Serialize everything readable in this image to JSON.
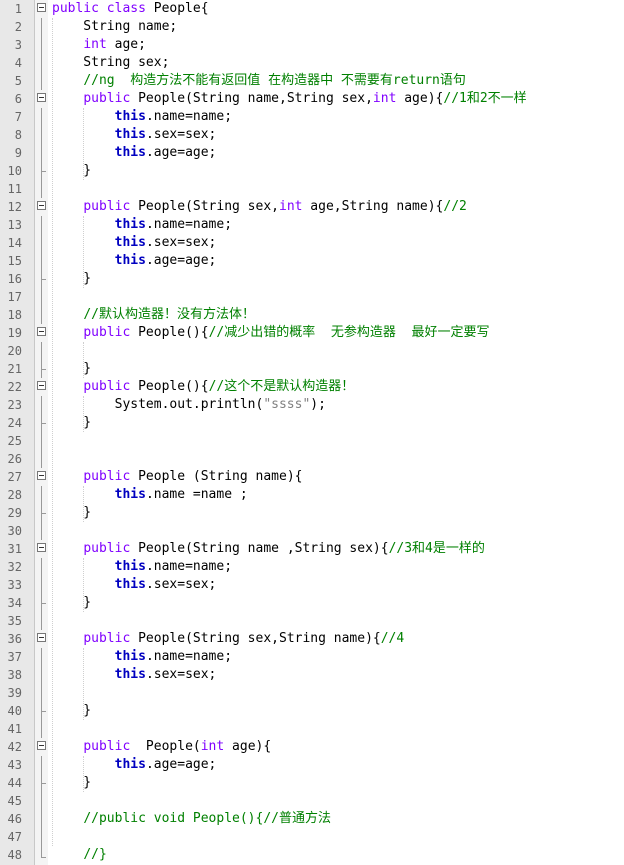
{
  "editor": {
    "lines": [
      {
        "num": "1",
        "fold": "open",
        "tokens": [
          {
            "t": "kw",
            "v": "public class"
          },
          {
            "t": "plain",
            "v": " People{"
          }
        ]
      },
      {
        "num": "2",
        "fold": "vline",
        "tokens": [
          {
            "t": "plain",
            "v": "    String name;"
          }
        ]
      },
      {
        "num": "3",
        "fold": "vline",
        "tokens": [
          {
            "t": "plain",
            "v": "    "
          },
          {
            "t": "kw",
            "v": "int"
          },
          {
            "t": "plain",
            "v": " age;"
          }
        ]
      },
      {
        "num": "4",
        "fold": "vline",
        "tokens": [
          {
            "t": "plain",
            "v": "    String sex;"
          }
        ]
      },
      {
        "num": "5",
        "fold": "vline",
        "tokens": [
          {
            "t": "plain",
            "v": "    "
          },
          {
            "t": "cm",
            "v": "//ng  构造方法不能有返回值 在构造器中 不需要有return语句"
          }
        ]
      },
      {
        "num": "6",
        "fold": "open",
        "tokens": [
          {
            "t": "plain",
            "v": "    "
          },
          {
            "t": "kw",
            "v": "public"
          },
          {
            "t": "plain",
            "v": " People(String name,String sex,"
          },
          {
            "t": "kw",
            "v": "int"
          },
          {
            "t": "plain",
            "v": " age){"
          },
          {
            "t": "cm",
            "v": "//1和2不一样"
          }
        ]
      },
      {
        "num": "7",
        "fold": "vline",
        "tokens": [
          {
            "t": "plain",
            "v": "        "
          },
          {
            "t": "this",
            "v": "this"
          },
          {
            "t": "plain",
            "v": ".name=name;"
          }
        ]
      },
      {
        "num": "8",
        "fold": "vline",
        "tokens": [
          {
            "t": "plain",
            "v": "        "
          },
          {
            "t": "this",
            "v": "this"
          },
          {
            "t": "plain",
            "v": ".sex=sex;"
          }
        ]
      },
      {
        "num": "9",
        "fold": "vline",
        "tokens": [
          {
            "t": "plain",
            "v": "        "
          },
          {
            "t": "this",
            "v": "this"
          },
          {
            "t": "plain",
            "v": ".age=age;"
          }
        ]
      },
      {
        "num": "10",
        "fold": "tick",
        "tokens": [
          {
            "t": "plain",
            "v": "    }"
          }
        ]
      },
      {
        "num": "11",
        "fold": "vline",
        "tokens": []
      },
      {
        "num": "12",
        "fold": "open",
        "tokens": [
          {
            "t": "plain",
            "v": "    "
          },
          {
            "t": "kw",
            "v": "public"
          },
          {
            "t": "plain",
            "v": " People(String sex,"
          },
          {
            "t": "kw",
            "v": "int"
          },
          {
            "t": "plain",
            "v": " age,String name){"
          },
          {
            "t": "cm",
            "v": "//2"
          }
        ]
      },
      {
        "num": "13",
        "fold": "vline",
        "tokens": [
          {
            "t": "plain",
            "v": "        "
          },
          {
            "t": "this",
            "v": "this"
          },
          {
            "t": "plain",
            "v": ".name=name;"
          }
        ]
      },
      {
        "num": "14",
        "fold": "vline",
        "tokens": [
          {
            "t": "plain",
            "v": "        "
          },
          {
            "t": "this",
            "v": "this"
          },
          {
            "t": "plain",
            "v": ".sex=sex;"
          }
        ]
      },
      {
        "num": "15",
        "fold": "vline",
        "tokens": [
          {
            "t": "plain",
            "v": "        "
          },
          {
            "t": "this",
            "v": "this"
          },
          {
            "t": "plain",
            "v": ".age=age;"
          }
        ]
      },
      {
        "num": "16",
        "fold": "tick",
        "tokens": [
          {
            "t": "plain",
            "v": "    }"
          }
        ]
      },
      {
        "num": "17",
        "fold": "vline",
        "tokens": []
      },
      {
        "num": "18",
        "fold": "vline",
        "tokens": [
          {
            "t": "plain",
            "v": "    "
          },
          {
            "t": "cm",
            "v": "//默认构造器！没有方法体！"
          }
        ]
      },
      {
        "num": "19",
        "fold": "open",
        "tokens": [
          {
            "t": "plain",
            "v": "    "
          },
          {
            "t": "kw",
            "v": "public"
          },
          {
            "t": "plain",
            "v": " People(){"
          },
          {
            "t": "cm",
            "v": "//减少出错的概率  无参构造器  最好一定要写"
          }
        ]
      },
      {
        "num": "20",
        "fold": "vline",
        "tokens": []
      },
      {
        "num": "21",
        "fold": "tick",
        "tokens": [
          {
            "t": "plain",
            "v": "    }"
          }
        ]
      },
      {
        "num": "22",
        "fold": "open",
        "tokens": [
          {
            "t": "plain",
            "v": "    "
          },
          {
            "t": "kw",
            "v": "public"
          },
          {
            "t": "plain",
            "v": " People(){"
          },
          {
            "t": "cm",
            "v": "//这个不是默认构造器！"
          }
        ]
      },
      {
        "num": "23",
        "fold": "vline",
        "tokens": [
          {
            "t": "plain",
            "v": "        System.out.println("
          },
          {
            "t": "str",
            "v": "\"ssss\""
          },
          {
            "t": "plain",
            "v": ");"
          }
        ]
      },
      {
        "num": "24",
        "fold": "tick",
        "tokens": [
          {
            "t": "plain",
            "v": "    }"
          }
        ]
      },
      {
        "num": "25",
        "fold": "vline",
        "tokens": []
      },
      {
        "num": "26",
        "fold": "vline",
        "tokens": []
      },
      {
        "num": "27",
        "fold": "open",
        "tokens": [
          {
            "t": "plain",
            "v": "    "
          },
          {
            "t": "kw",
            "v": "public"
          },
          {
            "t": "plain",
            "v": " People (String name){"
          }
        ]
      },
      {
        "num": "28",
        "fold": "vline",
        "tokens": [
          {
            "t": "plain",
            "v": "        "
          },
          {
            "t": "this",
            "v": "this"
          },
          {
            "t": "plain",
            "v": ".name =name ;"
          }
        ]
      },
      {
        "num": "29",
        "fold": "tick",
        "tokens": [
          {
            "t": "plain",
            "v": "    }"
          }
        ]
      },
      {
        "num": "30",
        "fold": "vline",
        "tokens": []
      },
      {
        "num": "31",
        "fold": "open",
        "tokens": [
          {
            "t": "plain",
            "v": "    "
          },
          {
            "t": "kw",
            "v": "public"
          },
          {
            "t": "plain",
            "v": " People(String name ,String sex){"
          },
          {
            "t": "cm",
            "v": "//3和4是一样的"
          }
        ]
      },
      {
        "num": "32",
        "fold": "vline",
        "tokens": [
          {
            "t": "plain",
            "v": "        "
          },
          {
            "t": "this",
            "v": "this"
          },
          {
            "t": "plain",
            "v": ".name=name;"
          }
        ]
      },
      {
        "num": "33",
        "fold": "vline",
        "tokens": [
          {
            "t": "plain",
            "v": "        "
          },
          {
            "t": "this",
            "v": "this"
          },
          {
            "t": "plain",
            "v": ".sex=sex;"
          }
        ]
      },
      {
        "num": "34",
        "fold": "tick",
        "tokens": [
          {
            "t": "plain",
            "v": "    }"
          }
        ]
      },
      {
        "num": "35",
        "fold": "vline",
        "tokens": []
      },
      {
        "num": "36",
        "fold": "open",
        "tokens": [
          {
            "t": "plain",
            "v": "    "
          },
          {
            "t": "kw",
            "v": "public"
          },
          {
            "t": "plain",
            "v": " People(String sex,String name){"
          },
          {
            "t": "cm",
            "v": "//4"
          }
        ]
      },
      {
        "num": "37",
        "fold": "vline",
        "tokens": [
          {
            "t": "plain",
            "v": "        "
          },
          {
            "t": "this",
            "v": "this"
          },
          {
            "t": "plain",
            "v": ".name=name;"
          }
        ]
      },
      {
        "num": "38",
        "fold": "vline",
        "tokens": [
          {
            "t": "plain",
            "v": "        "
          },
          {
            "t": "this",
            "v": "this"
          },
          {
            "t": "plain",
            "v": ".sex=sex;"
          }
        ]
      },
      {
        "num": "39",
        "fold": "vline",
        "tokens": []
      },
      {
        "num": "40",
        "fold": "tick",
        "tokens": [
          {
            "t": "plain",
            "v": "    }"
          }
        ]
      },
      {
        "num": "41",
        "fold": "vline",
        "tokens": []
      },
      {
        "num": "42",
        "fold": "open",
        "tokens": [
          {
            "t": "plain",
            "v": "    "
          },
          {
            "t": "kw",
            "v": "public"
          },
          {
            "t": "plain",
            "v": "  People("
          },
          {
            "t": "kw",
            "v": "int"
          },
          {
            "t": "plain",
            "v": " age){"
          }
        ]
      },
      {
        "num": "43",
        "fold": "vline",
        "tokens": [
          {
            "t": "plain",
            "v": "        "
          },
          {
            "t": "this",
            "v": "this"
          },
          {
            "t": "plain",
            "v": ".age=age;"
          }
        ]
      },
      {
        "num": "44",
        "fold": "tick",
        "tokens": [
          {
            "t": "plain",
            "v": "    }"
          }
        ]
      },
      {
        "num": "45",
        "fold": "vline",
        "tokens": []
      },
      {
        "num": "46",
        "fold": "vline",
        "tokens": [
          {
            "t": "plain",
            "v": "    "
          },
          {
            "t": "cm",
            "v": "//public void People(){//普通方法"
          }
        ]
      },
      {
        "num": "47",
        "fold": "vline",
        "tokens": []
      },
      {
        "num": "48",
        "fold": "end",
        "tokens": [
          {
            "t": "plain",
            "v": "    "
          },
          {
            "t": "cm",
            "v": "//}"
          }
        ]
      }
    ]
  }
}
